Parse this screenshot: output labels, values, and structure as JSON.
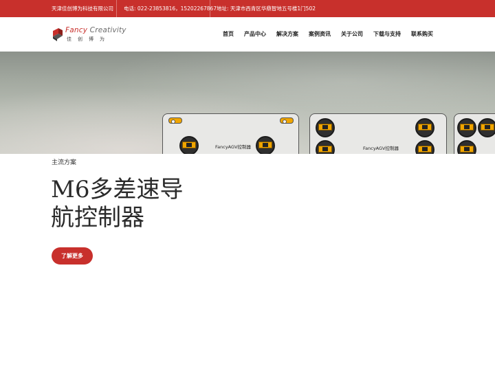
{
  "topbar": {
    "company": "天津佳创博为科技有限公司",
    "phone": "电话: 022-23853816，15202267867",
    "address": "地址: 天津市西青区华鼎智地五号楼1门502"
  },
  "logo": {
    "en_part1": "Fancy",
    "en_part2": "Creativity",
    "cn": "佳创博为",
    "mark_color": "#c8302c"
  },
  "nav": {
    "items": [
      {
        "label": "首页"
      },
      {
        "label": "产品中心"
      },
      {
        "label": "解决方案"
      },
      {
        "label": "案例资讯"
      },
      {
        "label": "关于公司"
      },
      {
        "label": "下载与支持"
      },
      {
        "label": "联系购买"
      }
    ]
  },
  "banner": {
    "board1_label": "FancyAGV控制器",
    "board2_label": "FancyAGV控制器"
  },
  "hero": {
    "subtitle": "主流方案",
    "title_line1": "M6多差速导",
    "title_line2": "航控制器",
    "cta_label": "了解更多"
  },
  "colors": {
    "accent": "#c8302c",
    "wheel_yellow": "#f0a500"
  }
}
